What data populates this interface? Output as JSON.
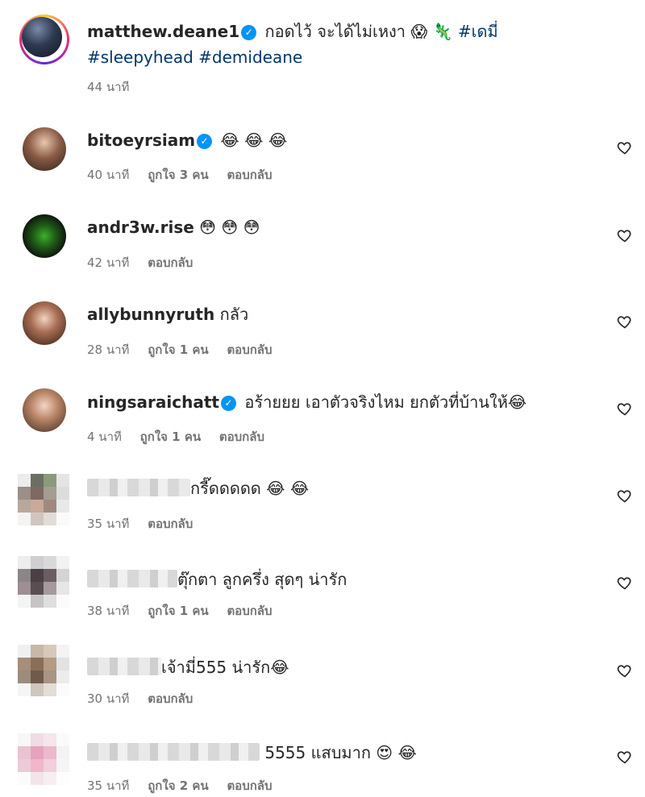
{
  "post": {
    "username": "matthew.deane1",
    "caption": "กอดไว้ จะได้ไม่เหงา",
    "emojis": "😱 🦎",
    "hashtags_line1": "#เดมี่",
    "hashtags_line2": "#sleepyhead #demideane",
    "time": "44 นาที"
  },
  "reply_label": "ตอบกลับ",
  "comments": [
    {
      "username": "bitoeyrsiam",
      "verified": true,
      "text": "😂 😂 😂",
      "time": "40 นาที",
      "likes": "ถูกใจ 3 คน"
    },
    {
      "username": "andr3w.rise",
      "verified": false,
      "text": "😳 😳 😳",
      "time": "42 นาที",
      "likes": ""
    },
    {
      "username": "allybunnyruth",
      "verified": false,
      "text": "กลัว",
      "time": "28 นาที",
      "likes": "ถูกใจ 1 คน"
    },
    {
      "username": "ningsaraichatt",
      "verified": true,
      "text": "อร้ายยย เอาตัวจริงไหม ยกตัวที่บ้านให้😂",
      "time": "4 นาที",
      "likes": "ถูกใจ 1 คน"
    },
    {
      "username": "",
      "verified": false,
      "text": "กรี๊ดดดดด 😂 😂",
      "time": "35 นาที",
      "likes": ""
    },
    {
      "username": "",
      "verified": false,
      "text": "ตุ๊กตา ลูกครึ่ง สุดๆ น่ารัก",
      "time": "38 นาที",
      "likes": "ถูกใจ 1 คน"
    },
    {
      "username": "",
      "verified": false,
      "text": "เจ้ามี่555 น่ารัก😂",
      "time": "30 นาที",
      "likes": ""
    },
    {
      "username": "",
      "verified": false,
      "text": "5555 แสบมาก 😍 😂",
      "time": "35 นาที",
      "likes": "ถูกใจ 2 คน"
    }
  ],
  "colors": {
    "text": "#262626",
    "meta": "#737373",
    "hashtag": "#00376b",
    "verified": "#0095f6"
  },
  "icons": {
    "verified": "verified-badge-icon",
    "like": "heart-outline-icon"
  }
}
